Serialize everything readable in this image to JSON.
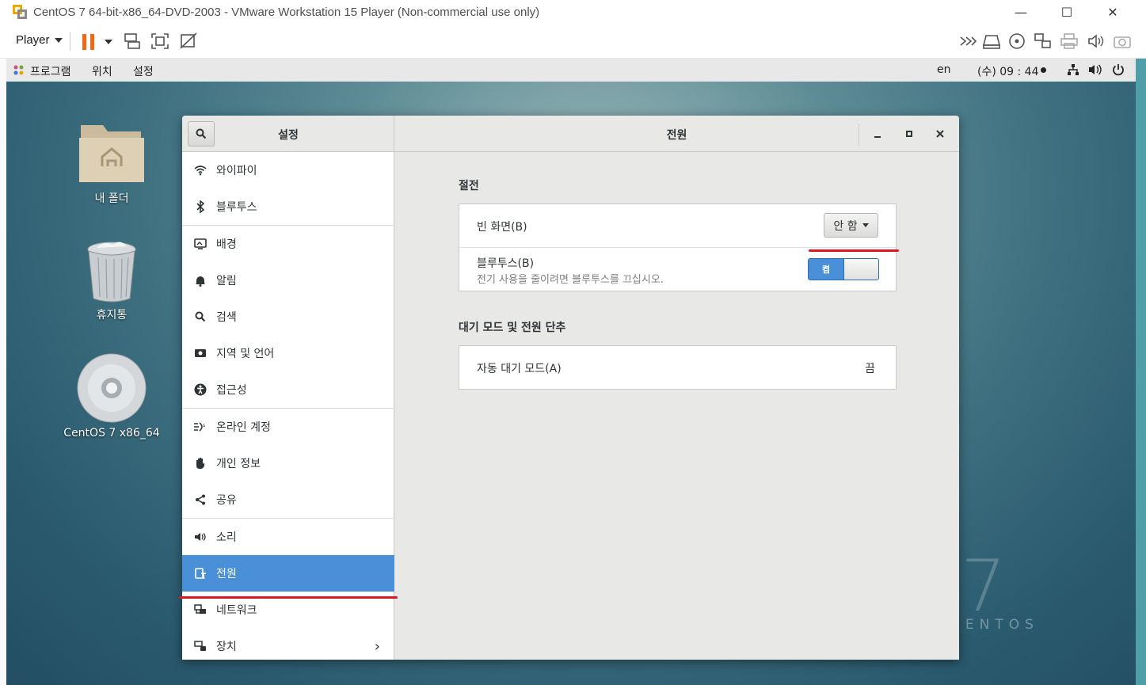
{
  "vmware": {
    "title": "CentOS 7 64-bit-x86_64-DVD-2003 - VMware Workstation 15 Player (Non-commercial use only)",
    "player_menu": "Player",
    "minimize": "—",
    "maximize": "☐",
    "close": "✕"
  },
  "gnome_topbar": {
    "menu_programs": "프로그램",
    "menu_places": "위치",
    "menu_settings": "설정",
    "input_lang": "en",
    "clock": "(수) 09 : 44"
  },
  "desktop": {
    "icons": [
      {
        "label": "내 폴더",
        "icon": "home-folder-icon"
      },
      {
        "label": "휴지통",
        "icon": "trash-icon"
      },
      {
        "label": "CentOS 7 x86_64",
        "icon": "dvd-icon"
      }
    ],
    "brand_numeral": "7",
    "brand_word": "CENTOS"
  },
  "settings": {
    "sidebar_title": "설정",
    "main_title": "전원",
    "sidebar_items": [
      {
        "label": "와이파이",
        "icon": "wifi-icon"
      },
      {
        "label": "블루투스",
        "icon": "bluetooth-icon"
      },
      {
        "label": "배경",
        "icon": "background-icon"
      },
      {
        "label": "알림",
        "icon": "notification-bell-icon"
      },
      {
        "label": "검색",
        "icon": "search-icon"
      },
      {
        "label": "지역 및 언어",
        "icon": "region-camera-icon"
      },
      {
        "label": "접근성",
        "icon": "accessibility-icon"
      },
      {
        "label": "온라인 계정",
        "icon": "online-accounts-icon"
      },
      {
        "label": "개인 정보",
        "icon": "privacy-hand-icon"
      },
      {
        "label": "공유",
        "icon": "share-icon"
      },
      {
        "label": "소리",
        "icon": "speaker-icon"
      },
      {
        "label": "전원",
        "icon": "power-icon",
        "active": true
      },
      {
        "label": "네트워크",
        "icon": "network-icon"
      },
      {
        "label": "장치",
        "icon": "devices-icon"
      }
    ],
    "power_saving": {
      "title": "절전",
      "blank_screen_label": "빈 화면(B)",
      "blank_screen_value": "안 함",
      "bluetooth_label": "블루투스(B)",
      "bluetooth_desc": "전기 사용을 줄이려면 블루투스를 끄십시오.",
      "bluetooth_switch": "켬"
    },
    "suspend": {
      "title": "대기 모드 및 전원 단추",
      "auto_suspend_label": "자동 대기 모드(A)",
      "auto_suspend_value": "끔"
    }
  },
  "colors": {
    "accent": "#4a90d9",
    "annotation_red": "#e0161e",
    "pause_orange": "#f06a14"
  }
}
